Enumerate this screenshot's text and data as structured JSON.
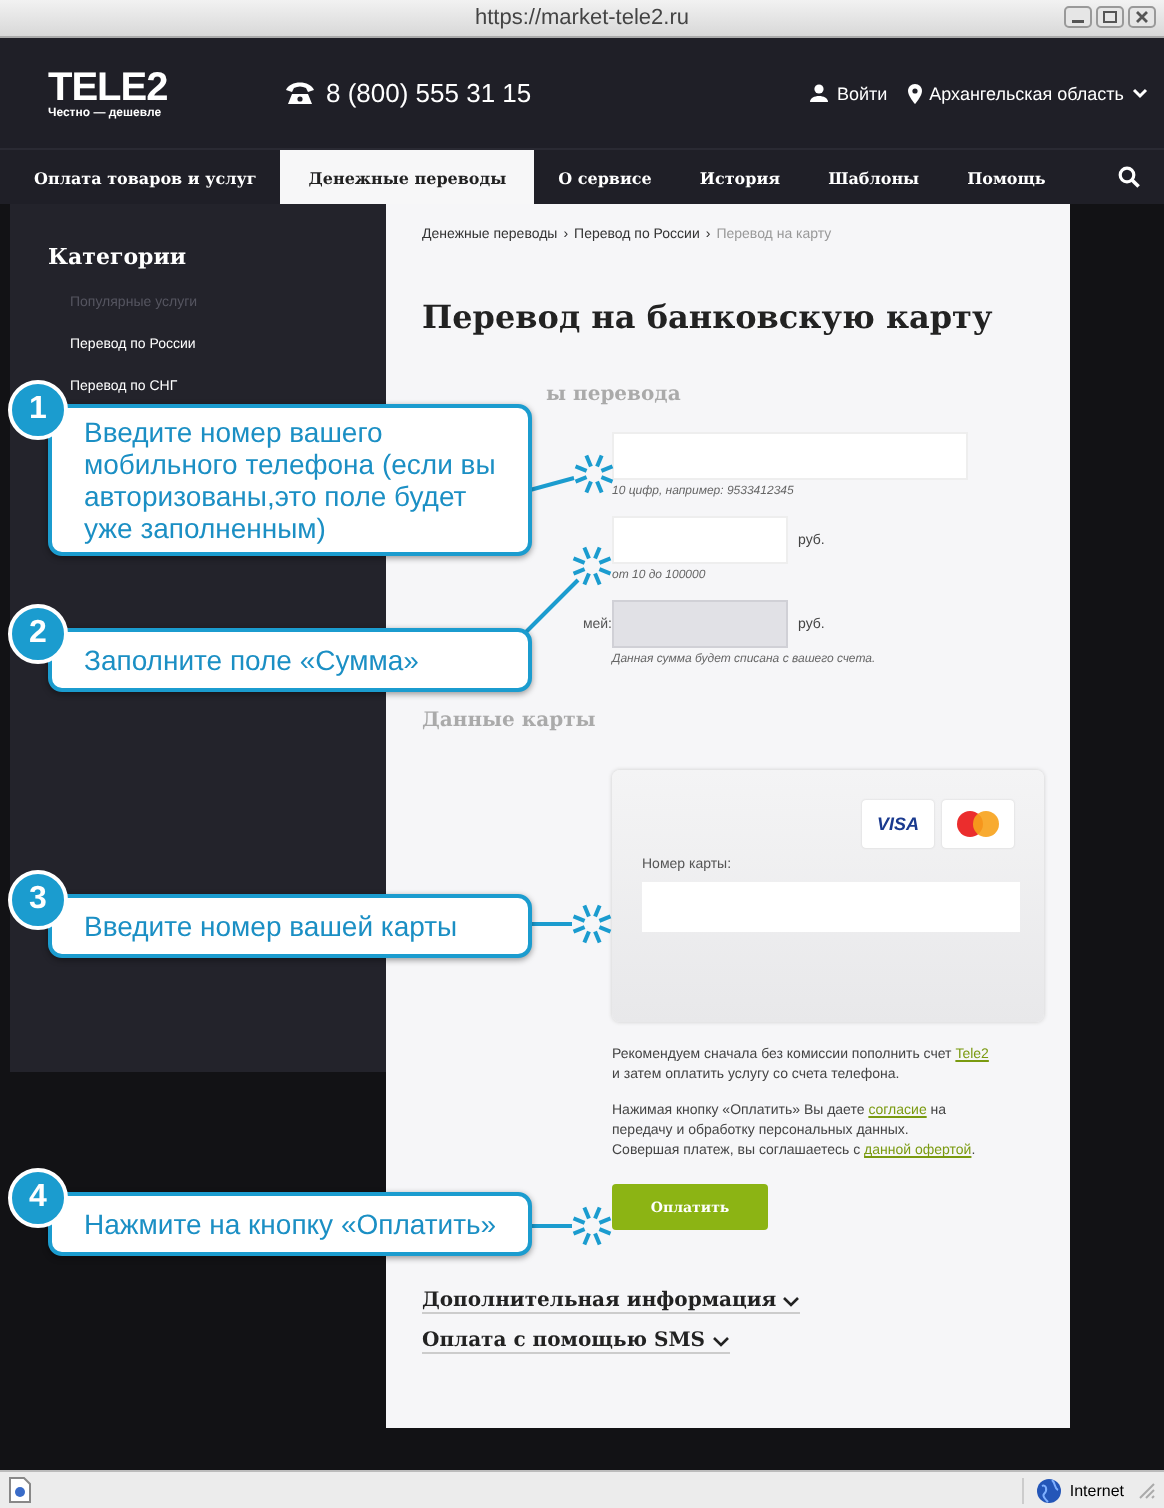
{
  "window": {
    "title": "https://market-tele2.ru"
  },
  "header": {
    "logo": "TELE2",
    "slogan": "Честно — дешевле",
    "phone": "8 (800) 555 31 15",
    "login": "Войти",
    "region": "Архангельская область"
  },
  "nav": [
    {
      "label": "Оплата товаров и услуг",
      "selected": false
    },
    {
      "label": "Денежные переводы",
      "selected": true
    },
    {
      "label": "О сервисе",
      "selected": false
    },
    {
      "label": "История",
      "selected": false
    },
    {
      "label": "Шаблоны",
      "selected": false
    },
    {
      "label": "Помощь",
      "selected": false
    }
  ],
  "sidebar": {
    "title": "Категории",
    "items": [
      {
        "label": "Популярные услуги",
        "dimmed": true
      },
      {
        "label": "Перевод по России",
        "dimmed": false
      },
      {
        "label": "Перевод по СНГ",
        "dimmed": false
      }
    ]
  },
  "breadcrumb": [
    {
      "kind": "link",
      "label": "Денежные переводы",
      "current": false
    },
    {
      "kind": "separator",
      "label": "›"
    },
    {
      "kind": "link",
      "label": "Перевод по России",
      "current": false
    },
    {
      "kind": "separator",
      "label": "›"
    },
    {
      "kind": "link",
      "label": "Перевод на карту",
      "current": true
    }
  ],
  "page_title": "Перевод на банковскую карту",
  "transfer_section": "ы перевода",
  "fields": [
    {
      "hint": "10 цифр, например: 9533412345",
      "kind": "wide",
      "disabled": false
    },
    {
      "unit": "руб.",
      "hint": "от 10 до 100000",
      "kind": "short",
      "disabled": false
    },
    {
      "label": "мей:",
      "unit": "руб.",
      "hint": "Данная сумма будет списана с вашего счета.",
      "kind": "short",
      "disabled": true
    }
  ],
  "card_section": "Данные карты",
  "card": {
    "brands": [
      "VISA"
    ],
    "number_label": "Номер карты:"
  },
  "notes": [
    [
      {
        "kind": "text",
        "text": "Рекомендуем сначала без комиссии пополнить счет "
      },
      {
        "kind": "link",
        "text": "Tele2"
      },
      {
        "kind": "break"
      },
      {
        "kind": "text",
        "text": "и затем оплатить услугу со счета телефона."
      }
    ],
    [
      {
        "kind": "text",
        "text": "Нажимая кнопку «Оплатить» Вы даете "
      },
      {
        "kind": "link",
        "text": "согласие"
      },
      {
        "kind": "text",
        "text": " на"
      },
      {
        "kind": "break"
      },
      {
        "kind": "text",
        "text": "передачу и обработку персональных данных."
      },
      {
        "kind": "break"
      },
      {
        "kind": "text",
        "text": "Совершая платеж, вы соглашаетесь с "
      },
      {
        "kind": "link",
        "text": "данной офертой"
      },
      {
        "kind": "text",
        "text": "."
      }
    ]
  ],
  "pay_button": "Оплатить",
  "accordions": [
    {
      "label": "Дополнительная информация",
      "expanded": false
    },
    {
      "label": "Оплата с помощью SMS",
      "expanded": false
    }
  ],
  "callouts": [
    {
      "number": "1",
      "text": "Введите номер вашего мобильного телефона (если вы авторизованы,это поле будет уже заполненным)"
    },
    {
      "number": "2",
      "text": "Заполните поле «Сумма»"
    },
    {
      "number": "3",
      "text": "Введите номер вашей карты"
    },
    {
      "number": "4",
      "text": "Нажмите на кнопку «Оплатить»"
    }
  ],
  "status_bar": {
    "zone": "Internet"
  }
}
